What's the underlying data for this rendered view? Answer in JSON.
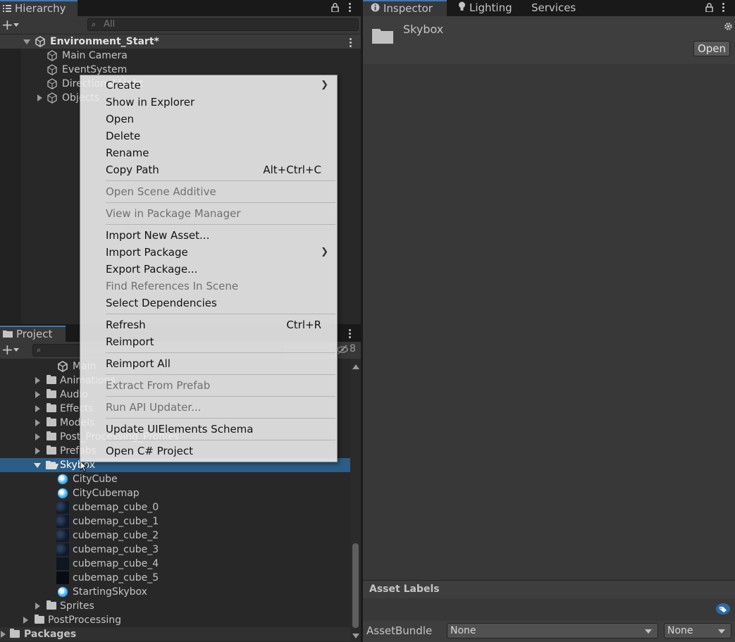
{
  "hierarchy": {
    "tab_label": "Hierarchy",
    "search_placeholder": "All",
    "scene_name": "Environment_Start*",
    "items": [
      "Main Camera",
      "EventSystem",
      "Directional Light",
      "Objects"
    ]
  },
  "inspector": {
    "tabs": [
      "Inspector",
      "Lighting",
      "Services"
    ],
    "asset_name": "Skybox",
    "open_button": "Open",
    "asset_labels_title": "Asset Labels",
    "assetbundle_label": "AssetBundle",
    "assetbundle_value": "None",
    "assetbundle_variant": "None"
  },
  "project": {
    "tab_label": "Project",
    "hidden_count": "8",
    "tree": [
      {
        "label": "Main",
        "type": "scene"
      },
      {
        "label": "Animations",
        "type": "folder"
      },
      {
        "label": "Audio",
        "type": "folder"
      },
      {
        "label": "Effects",
        "type": "folder"
      },
      {
        "label": "Models",
        "type": "folder"
      },
      {
        "label": "Post_Processing_Profiles",
        "type": "folder"
      },
      {
        "label": "Prefabs",
        "type": "folder"
      },
      {
        "label": "Skybox",
        "type": "folder-open",
        "selected": true
      },
      {
        "label": "CityCube",
        "type": "material"
      },
      {
        "label": "CityCubemap",
        "type": "material"
      },
      {
        "label": "cubemap_cube_0",
        "type": "texture"
      },
      {
        "label": "cubemap_cube_1",
        "type": "texture"
      },
      {
        "label": "cubemap_cube_2",
        "type": "texture"
      },
      {
        "label": "cubemap_cube_3",
        "type": "texture"
      },
      {
        "label": "cubemap_cube_4",
        "type": "texture"
      },
      {
        "label": "cubemap_cube_5",
        "type": "texture"
      },
      {
        "label": "StartingSkybox",
        "type": "material"
      },
      {
        "label": "Sprites",
        "type": "folder"
      },
      {
        "label": "PostProcessing",
        "type": "folder"
      },
      {
        "label": "Packages",
        "type": "folder"
      }
    ]
  },
  "context_menu": {
    "items": [
      {
        "label": "Create",
        "submenu": true
      },
      {
        "label": "Show in Explorer"
      },
      {
        "label": "Open"
      },
      {
        "label": "Delete"
      },
      {
        "label": "Rename"
      },
      {
        "label": "Copy Path",
        "shortcut": "Alt+Ctrl+C"
      },
      {
        "label": "Open Scene Additive",
        "disabled": true
      },
      {
        "label": "View in Package Manager",
        "disabled": true
      },
      {
        "label": "Import New Asset..."
      },
      {
        "label": "Import Package",
        "submenu": true
      },
      {
        "label": "Export Package..."
      },
      {
        "label": "Find References In Scene",
        "disabled": true
      },
      {
        "label": "Select Dependencies"
      },
      {
        "label": "Refresh",
        "shortcut": "Ctrl+R"
      },
      {
        "label": "Reimport"
      },
      {
        "label": "Reimport All"
      },
      {
        "label": "Extract From Prefab",
        "disabled": true
      },
      {
        "label": "Run API Updater...",
        "disabled": true
      },
      {
        "label": "Update UIElements Schema"
      },
      {
        "label": "Open C# Project"
      }
    ]
  },
  "colors": {
    "selection": "#2c5d87",
    "tab_accent": "#3a79bb",
    "panel": "#383838",
    "tree_bg": "#282828"
  }
}
